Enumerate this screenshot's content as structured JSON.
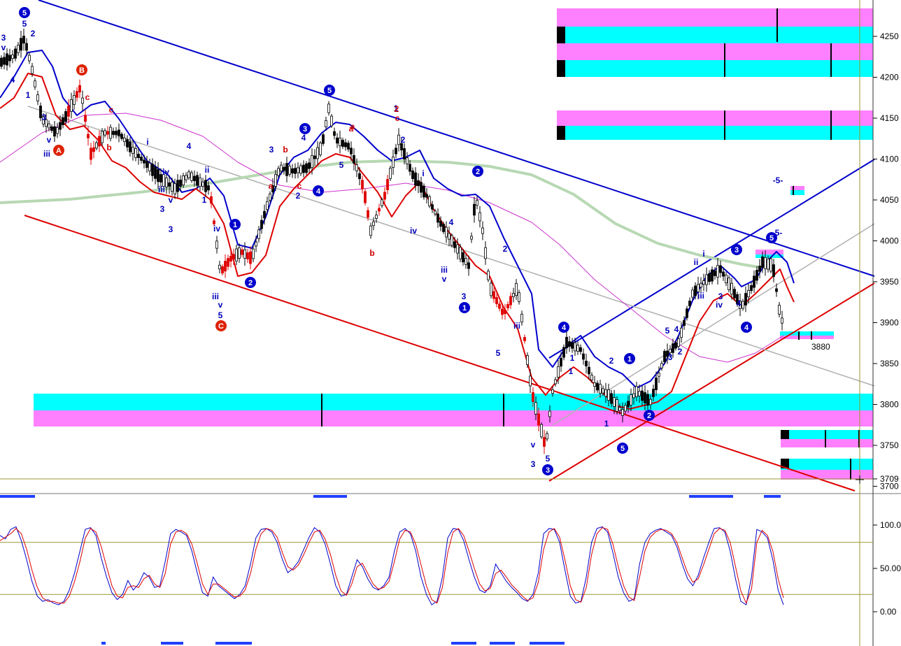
{
  "chart_data": [
    {
      "type": "line",
      "panel": "price",
      "title": "",
      "xlabel": "",
      "ylabel": "",
      "ylim": [
        3700,
        4290
      ],
      "y_ticks": [
        "4250",
        "4200",
        "4150",
        "4100",
        "4050",
        "4000",
        "3950",
        "3900",
        "3850",
        "3800",
        "3750",
        "3709",
        "3700"
      ],
      "grid": false,
      "annotations": {
        "target_label": "3880",
        "wave_labels_blue": [
          "3",
          "v",
          "4",
          "5",
          "1",
          "2",
          "3",
          "iii",
          "v",
          "3",
          "i",
          "iv",
          "iii",
          "v",
          "3",
          "4",
          "1",
          "ii",
          "iv",
          "iii",
          "v",
          "5",
          "3",
          "4",
          "5",
          "2",
          "1",
          "2",
          "i",
          "iv",
          "iii",
          "4",
          "v",
          "3",
          "5",
          "1",
          "1",
          "2",
          "iii",
          "v",
          "3",
          "5",
          "1",
          "2",
          "3",
          "4",
          "5",
          "2",
          "i",
          "ii",
          "iii",
          "iv",
          "3",
          "4",
          "-5-",
          "5-"
        ],
        "wave_labels_red": [
          "a",
          "b",
          "c",
          "b",
          "c",
          "a",
          "c",
          "a",
          "b",
          "2",
          "c"
        ],
        "circled_blue": [
          "5",
          "5",
          "3",
          "4",
          "1",
          "2",
          "2",
          "1",
          "3",
          "4",
          "1",
          "2",
          "5",
          "3",
          "4",
          "5"
        ],
        "circled_red": [
          "B",
          "A",
          "C"
        ]
      },
      "colors": {
        "candles_up": "#ffffff",
        "candles_down": "#000000",
        "candles_down_red": "#e00000",
        "upper_band": "#0000cc",
        "lower_band": "#dd0000",
        "ma_slow": "#b7d8b3",
        "ma_mid": "#cc33cc",
        "channel_upper": "#0000cc",
        "channel_lower": "#dd0000",
        "mid_line": "#b0b0b0",
        "zone_cyan": "#00ffff",
        "zone_magenta": "#ff80ff",
        "hline": "#999933"
      }
    },
    {
      "type": "line",
      "panel": "stochastic",
      "title": "",
      "ylim": [
        0,
        100
      ],
      "y_ticks": [
        "100.00",
        "50.00",
        "0.00"
      ],
      "levels": [
        80,
        20
      ],
      "series": [
        {
          "values": [
            88,
            84,
            95,
            98,
            82,
            60,
            35,
            18,
            12,
            14,
            10,
            8,
            12,
            25,
            45,
            70,
            95,
            97,
            88,
            62,
            40,
            22,
            14,
            20,
            36,
            25,
            32,
            45,
            40,
            28,
            30,
            58,
            90,
            95,
            92,
            88,
            70,
            45,
            22,
            18,
            40,
            30,
            25,
            20,
            15,
            20,
            30,
            55,
            85,
            95,
            96,
            92,
            80,
            60,
            45,
            50,
            58,
            72,
            86,
            97,
            92,
            78,
            55,
            30,
            18,
            20,
            40,
            60,
            52,
            38,
            28,
            25,
            30,
            40,
            70,
            92,
            96,
            90,
            70,
            40,
            20,
            8,
            12,
            40,
            85,
            96,
            95,
            82,
            60,
            40,
            25,
            22,
            30,
            55,
            45,
            35,
            28,
            22,
            15,
            12,
            20,
            45,
            90,
            96,
            95,
            80,
            48,
            18,
            10,
            12,
            40,
            80,
            96,
            98,
            92,
            68,
            40,
            22,
            12,
            15,
            55,
            80,
            90,
            94,
            96,
            92,
            88,
            75,
            55,
            38,
            30,
            42,
            62,
            80,
            96,
            97,
            92,
            70,
            38,
            12,
            8,
            40,
            95,
            92,
            85,
            60,
            25,
            8
          ]
        },
        {
          "values": [
            82,
            86,
            90,
            96,
            90,
            72,
            48,
            28,
            16,
            12,
            12,
            10,
            10,
            18,
            35,
            58,
            85,
            96,
            92,
            75,
            52,
            30,
            18,
            16,
            28,
            30,
            28,
            38,
            42,
            32,
            28,
            44,
            78,
            92,
            94,
            90,
            78,
            56,
            32,
            20,
            32,
            32,
            27,
            22,
            17,
            18,
            25,
            44,
            72,
            90,
            96,
            94,
            86,
            68,
            52,
            48,
            54,
            66,
            80,
            92,
            94,
            84,
            66,
            42,
            24,
            19,
            32,
            52,
            56,
            44,
            32,
            26,
            28,
            35,
            58,
            84,
            94,
            92,
            78,
            54,
            30,
            14,
            10,
            28,
            68,
            92,
            96,
            88,
            70,
            50,
            32,
            24,
            27,
            44,
            48,
            40,
            31,
            25,
            18,
            13,
            16,
            34,
            72,
            92,
            96,
            86,
            60,
            30,
            14,
            11,
            28,
            66,
            90,
            97,
            95,
            78,
            52,
            30,
            17,
            13,
            40,
            70,
            86,
            92,
            95,
            94,
            90,
            80,
            62,
            45,
            34,
            38,
            54,
            72,
            90,
            96,
            94,
            80,
            52,
            24,
            10,
            26,
            80,
            94,
            88,
            70,
            38,
            16
          ]
        }
      ]
    }
  ]
}
